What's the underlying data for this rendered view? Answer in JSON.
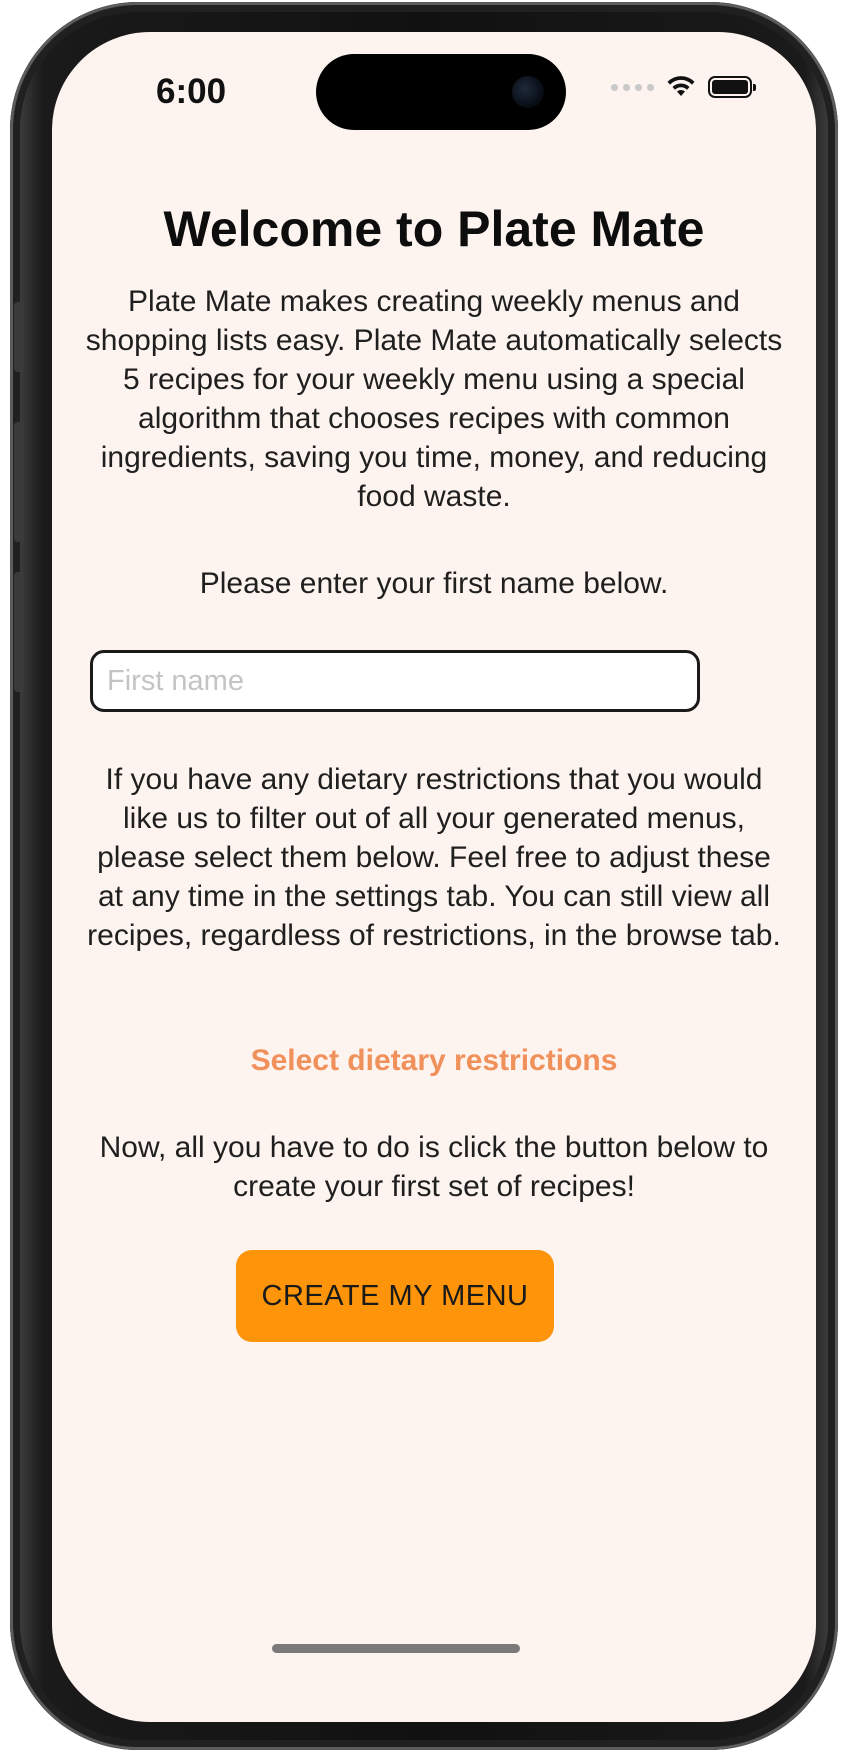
{
  "status_bar": {
    "time": "6:00",
    "icons": [
      "cellular-dots-icon",
      "wifi-icon",
      "battery-icon"
    ]
  },
  "welcome": {
    "title": "Welcome to Plate Mate",
    "intro": "Plate Mate makes creating weekly menus and shopping lists easy. Plate Mate automatically selects 5 recipes for your weekly menu using a special algorithm that chooses recipes with common ingredients, saving you time, money, and reducing food waste.",
    "name_prompt": "Please enter your first name below.",
    "name_input": {
      "value": "",
      "placeholder": "First name"
    },
    "restrictions_text": "If you have any dietary restrictions that you would like us to filter out of all your generated menus, please select them below. Feel free to adjust these at any time in the settings tab. You can still view all recipes, regardless of restrictions, in the browse tab.",
    "restrictions_link": "Select dietary restrictions",
    "final_text": "Now, all you have to do is click the button below to create your first set of recipes!",
    "create_button": "CREATE MY MENU"
  },
  "colors": {
    "background": "#fdf3ef",
    "accent_link": "#f0905a",
    "button": "#fd9409"
  }
}
